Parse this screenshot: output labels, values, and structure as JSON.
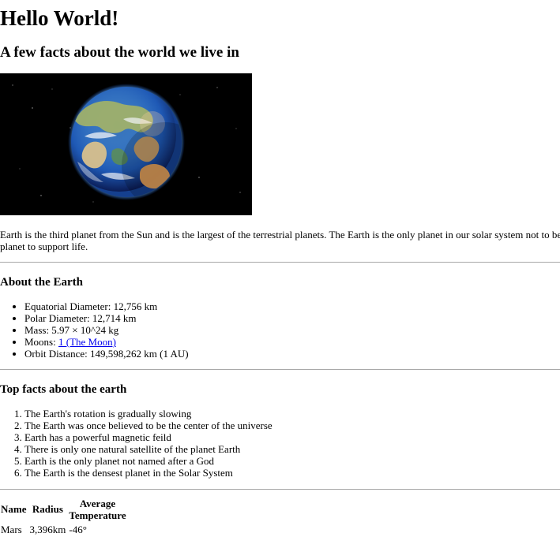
{
  "header": {
    "title": "Hello World!",
    "subtitle": "A few facts about the world we live in"
  },
  "image": {
    "icon": "earth-globe-photo"
  },
  "intro": {
    "line1": "Earth is the third planet from the Sun and is the largest of the terrestrial planets. The Earth is the only planet in our solar system not to be n",
    "line2": "planet to support life."
  },
  "about": {
    "heading": "About the Earth",
    "items": [
      "Equatorial Diameter: 12,756 km",
      "Polar Diameter: 12,714 km",
      "Mass: 5.97 × 10^24 kg",
      "Moons: ",
      "Orbit Distance: 149,598,262 km (1 AU)"
    ],
    "moons_link": "1 (The Moon)"
  },
  "facts": {
    "heading": "Top facts about the earth",
    "items": [
      "The Earth's rotation is gradually slowing",
      "The Earth was once believed to be the center of the universe",
      "Earth has a powerful magnetic feild",
      "There is only one natural satellite of the planet Earth",
      "Earth is the only planet not named after a God",
      "The Earth is the densest planet in the Solar System"
    ]
  },
  "table": {
    "headers": [
      "Name",
      "Radius",
      "Average",
      "Temperature"
    ],
    "rows": [
      [
        "Mars",
        "3,396km",
        "-46°"
      ]
    ]
  },
  "colors": {
    "link": "#0000ee",
    "rule": "#a8a8a8",
    "image_background": "#000000",
    "ocean": "#2d65c8",
    "land": "#d6ad72"
  }
}
